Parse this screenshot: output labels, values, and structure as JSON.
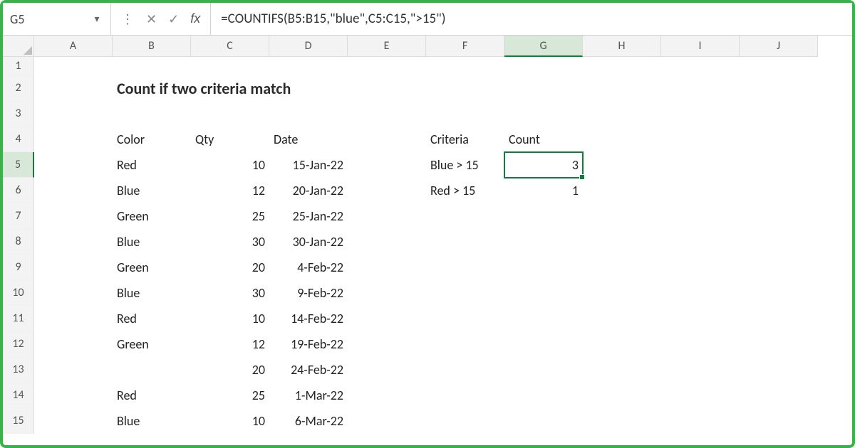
{
  "namebox": {
    "value": "G5"
  },
  "formula": "=COUNTIFS(B5:B15,\"blue\",C5:C15,\">15\")",
  "fx_label": "fx",
  "columns": [
    "A",
    "B",
    "C",
    "D",
    "E",
    "F",
    "G",
    "H",
    "I",
    "J"
  ],
  "rows_count": 15,
  "active_col": "G",
  "active_row": 5,
  "title": "Count if two criteria match",
  "main_table": {
    "headers": {
      "color": "Color",
      "qty": "Qty",
      "date": "Date"
    },
    "rows": [
      {
        "color": "Red",
        "qty": "10",
        "date": "15-Jan-22"
      },
      {
        "color": "Blue",
        "qty": "12",
        "date": "20-Jan-22"
      },
      {
        "color": "Green",
        "qty": "25",
        "date": "25-Jan-22"
      },
      {
        "color": "Blue",
        "qty": "30",
        "date": "30-Jan-22"
      },
      {
        "color": "Green",
        "qty": "20",
        "date": "4-Feb-22"
      },
      {
        "color": "Blue",
        "qty": "30",
        "date": "9-Feb-22"
      },
      {
        "color": "Red",
        "qty": "10",
        "date": "14-Feb-22"
      },
      {
        "color": "Green",
        "qty": "12",
        "date": "19-Feb-22"
      },
      {
        "color": "",
        "qty": "20",
        "date": "24-Feb-22"
      },
      {
        "color": "Red",
        "qty": "25",
        "date": "1-Mar-22"
      },
      {
        "color": "Blue",
        "qty": "10",
        "date": "6-Mar-22"
      }
    ]
  },
  "result_table": {
    "headers": {
      "criteria": "Criteria",
      "count": "Count"
    },
    "rows": [
      {
        "criteria": "Blue > 15",
        "count": "3"
      },
      {
        "criteria": "Red > 15",
        "count": "1"
      }
    ]
  }
}
